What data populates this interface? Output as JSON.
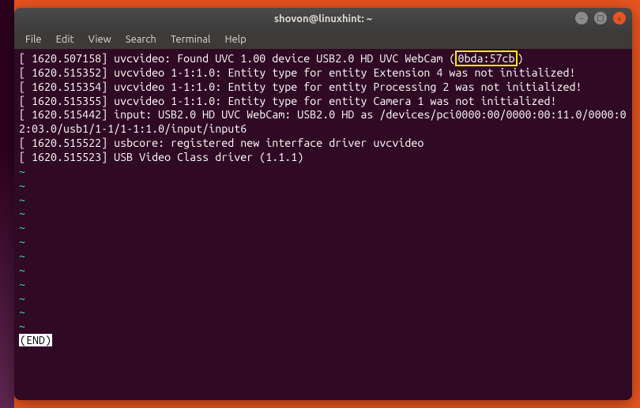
{
  "window": {
    "title": "shovon@linuxhint: ~"
  },
  "menu": {
    "file": "File",
    "edit": "Edit",
    "view": "View",
    "search": "Search",
    "terminal": "Terminal",
    "help": "Help"
  },
  "terminal": {
    "line1_pre": "[ 1620.507158] uvcvideo: Found UVC 1.00 device USB2.0 HD UVC WebCam (",
    "highlight": "0bda:57cb",
    "line1_post": ")",
    "line2": "[ 1620.515352] uvcvideo 1-1:1.0: Entity type for entity Extension 4 was not initialized!",
    "line3": "[ 1620.515354] uvcvideo 1-1:1.0: Entity type for entity Processing 2 was not initialized!",
    "line4": "[ 1620.515355] uvcvideo 1-1:1.0: Entity type for entity Camera 1 was not initialized!",
    "line5": "[ 1620.515442] input: USB2.0 HD UVC WebCam: USB2.0 HD as /devices/pci0000:00/0000:00:11.0/0000:02:03.0/usb1/1-1/1-1:1.0/input/input6",
    "line6": "[ 1620.515522] usbcore: registered new interface driver uvcvideo",
    "line7": "[ 1620.515523] USB Video Class driver (1.1.1)",
    "tilde": "~",
    "end": "(END)"
  },
  "controls": {
    "min": "–",
    "max": "□",
    "close": "×"
  }
}
